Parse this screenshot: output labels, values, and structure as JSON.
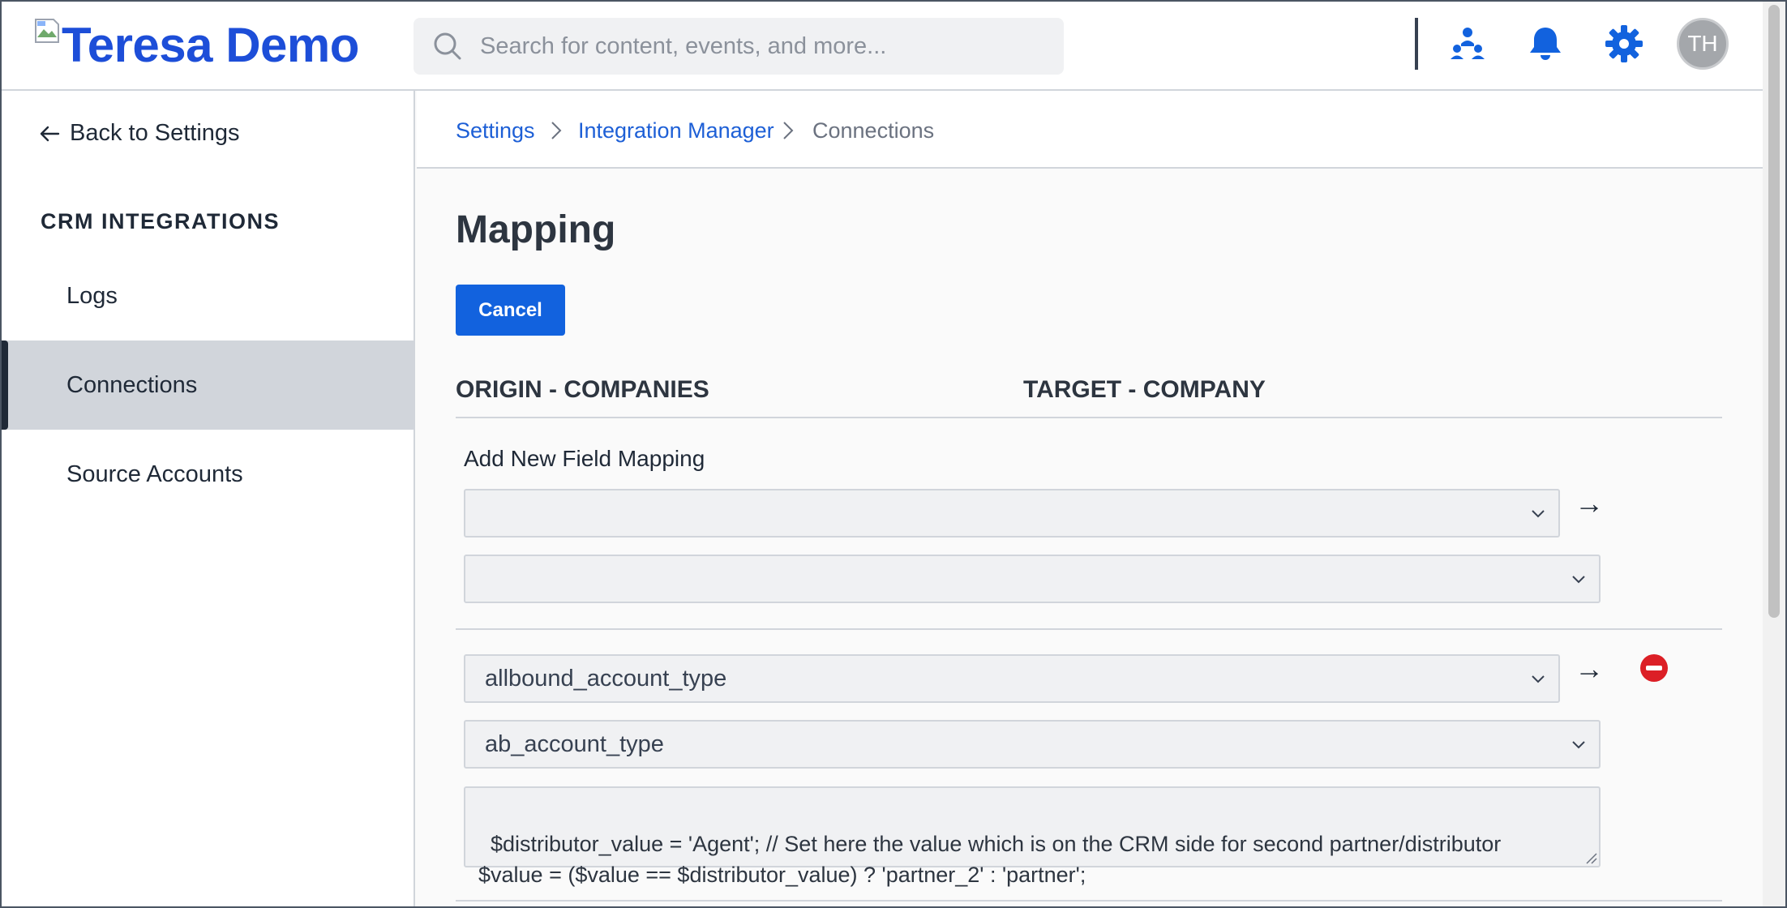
{
  "header": {
    "brand": "Teresa Demo",
    "search_placeholder": "Search for content, events, and more...",
    "avatar_initials": "TH",
    "icons": [
      "org-chart-icon",
      "bell-icon",
      "gear-icon"
    ],
    "accent_color": "#1262de"
  },
  "sidebar": {
    "back_label": "Back to Settings",
    "section_title": "CRM INTEGRATIONS",
    "items": [
      {
        "label": "Logs",
        "active": false
      },
      {
        "label": "Connections",
        "active": true
      },
      {
        "label": "Source Accounts",
        "active": false
      }
    ]
  },
  "breadcrumb": [
    {
      "label": "Settings"
    },
    {
      "label": "Integration Manager"
    },
    {
      "label": "Connections"
    }
  ],
  "main": {
    "title": "Mapping",
    "cancel_label": "Cancel",
    "origin_heading": "ORIGIN - COMPANIES",
    "target_heading": "TARGET - COMPANY",
    "add_label": "Add New Field Mapping",
    "new_mapping": {
      "origin_value": "",
      "target_value": ""
    },
    "mappings": [
      {
        "origin_value": "allbound_account_type",
        "target_value": "ab_account_type",
        "script": "$distributor_value = 'Agent'; // Set here the value which is on the CRM side for second partner/distributor\n$value = ($value == $distributor_value) ? 'partner_2' : 'partner';"
      }
    ],
    "arrow_glyph": "→"
  }
}
